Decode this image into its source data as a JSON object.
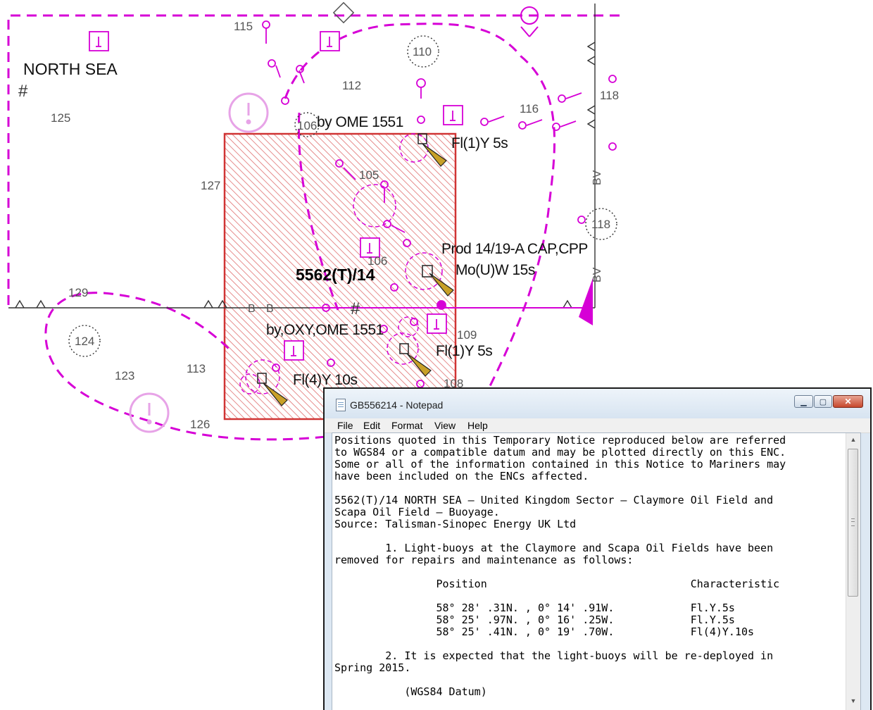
{
  "chart": {
    "area_name": "NORTH SEA",
    "notice_id": "5562(T)/14",
    "soundings": [
      "115",
      "110",
      "112",
      "118",
      "125",
      "106",
      "116",
      "105",
      "127",
      "118",
      "106",
      "129",
      "124",
      "123",
      "113",
      "109",
      "126",
      "108"
    ],
    "labels": {
      "operator_1": "by OME 1551",
      "light_1": "Fl(1)Y 5s",
      "platform": "Prod 14/19-A CAP,CPP",
      "platform_light": "Mo(U)W 15s",
      "operator_2": "by,OXY,OME 1551",
      "light_2": "Fl(1)Y 5s",
      "light_3": "Fl(4)Y 10s"
    },
    "colors": {
      "magenta": "#d600d6",
      "notice_area": "#d03434",
      "light_flare": "#c8a028",
      "info_symbol": "#e7a3e7"
    }
  },
  "notepad": {
    "title": "GB556214 - Notepad",
    "menu": [
      "File",
      "Edit",
      "Format",
      "View",
      "Help"
    ],
    "window_buttons": {
      "minimize": "▁",
      "maximize": "▢",
      "close": "✕"
    },
    "scroll": {
      "up": "▲",
      "down": "▼"
    },
    "content": "Positions quoted in this Temporary Notice reproduced below are referred\nto WGS84 or a compatible datum and may be plotted directly on this ENC.\nSome or all of the information contained in this Notice to Mariners may\nhave been included on the ENCs affected.\n\n5562(T)/14 NORTH SEA – United Kingdom Sector – Claymore Oil Field and\nScapa Oil Field – Buoyage.\nSource: Talisman-Sinopec Energy UK Ltd\n\n        1. Light-buoys at the Claymore and Scapa Oil Fields have been\nremoved for repairs and maintenance as follows:\n\n                Position                                Characteristic\n\n                58° 28' .31N. , 0° 14' .91W.            Fl.Y.5s\n                58° 25' .97N. , 0° 16' .25W.            Fl.Y.5s\n                58° 25' .41N. , 0° 19' .70W.            Fl(4)Y.10s\n\n        2. It is expected that the light-buoys will be re-deployed in\nSpring 2015.\n\n           (WGS84 Datum)"
  }
}
